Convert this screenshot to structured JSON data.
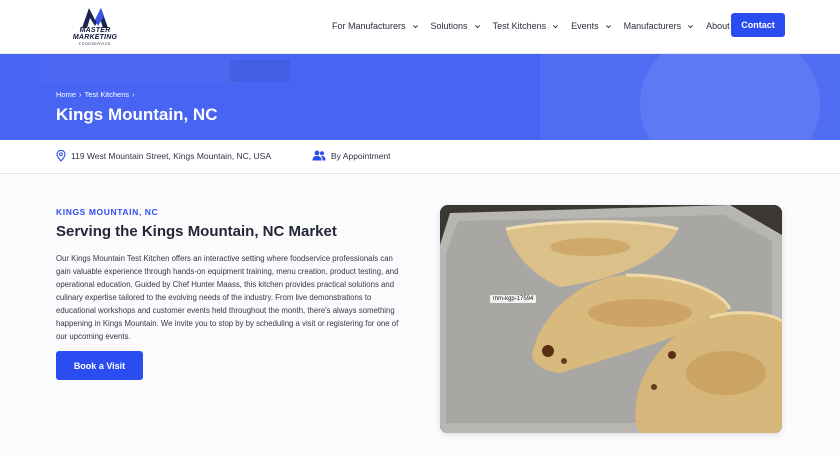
{
  "brand": {
    "line1": "MASTER",
    "line2": "MARKETING",
    "line3": "FOODSERVICE"
  },
  "nav": {
    "items": [
      {
        "label": "For Manufacturers"
      },
      {
        "label": "Solutions"
      },
      {
        "label": "Test Kitchens"
      },
      {
        "label": "Events"
      },
      {
        "label": "Manufacturers"
      },
      {
        "label": "About"
      }
    ],
    "contact_label": "Contact"
  },
  "hero": {
    "breadcrumb": [
      "Home",
      "›",
      "Test Kitchens",
      "›"
    ],
    "title": "Kings Mountain, NC"
  },
  "info": {
    "address": "119 West Mountain Street, Kings Mountain, NC, USA",
    "availability": "By Appointment"
  },
  "section": {
    "eyebrow": "KINGS MOUNTAIN, NC",
    "title": "Serving the Kings Mountain, NC Market",
    "description": "Our Kings Mountain Test Kitchen offers an interactive setting where foodservice professionals can gain valuable experience through hands-on equipment training, menu creation, product testing, and operational education. Guided by Chef Hunter Maass, this kitchen provides practical solutions and culinary expertise tailored to the evolving needs of the industry. From live demonstrations to educational workshops and customer events held throughout the month, there's always something happening in Kings Mountain. We invite you to stop by by scheduling a visit or registering for one of our upcoming events.",
    "book_label": "Book a Visit",
    "image_tag": "mm-kgp-17594"
  },
  "colors": {
    "accent": "#2b4cf0",
    "hero": "#4864f2",
    "eyebrow": "#3050ec"
  },
  "icons": {
    "location": "map-pin-icon",
    "people": "users-icon",
    "chevron": "chevron-down-icon"
  }
}
